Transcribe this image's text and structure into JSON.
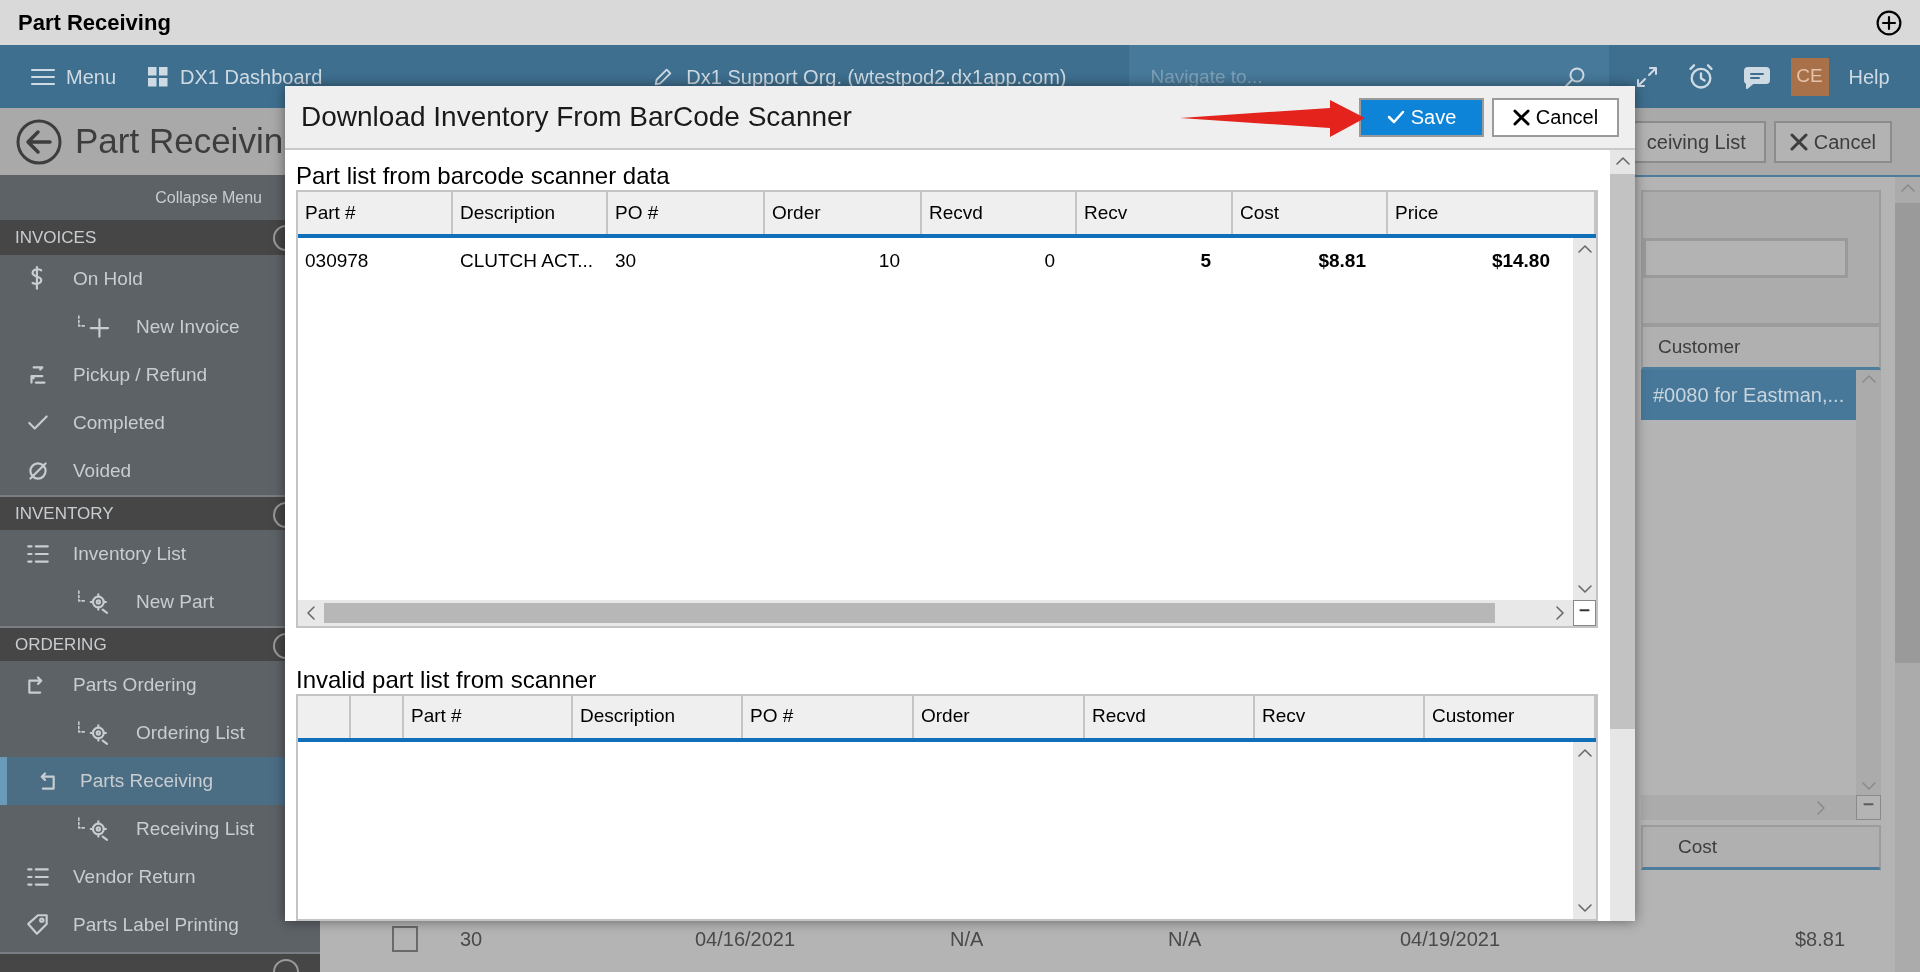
{
  "app_title": "Part Receiving",
  "nav": {
    "menu": "Menu",
    "dashboard": "DX1 Dashboard",
    "org": "Dx1 Support Org. (wtestpod2.dx1app.com)",
    "search_placeholder": "Navigate to...",
    "avatar": "CE",
    "help": "Help"
  },
  "sidebar": {
    "collapse": "Collapse Menu",
    "sections": [
      {
        "title": "INVOICES",
        "items": [
          {
            "label": "On Hold",
            "selected": false,
            "children": [
              {
                "label": "New Invoice",
                "selected": false
              }
            ]
          },
          {
            "label": "Pickup / Refund",
            "selected": false
          },
          {
            "label": "Completed",
            "selected": false
          },
          {
            "label": "Voided",
            "selected": false
          }
        ]
      },
      {
        "title": "INVENTORY",
        "items": [
          {
            "label": "Inventory List",
            "selected": false,
            "children": [
              {
                "label": "New Part",
                "selected": false
              }
            ]
          }
        ]
      },
      {
        "title": "ORDERING",
        "items": [
          {
            "label": "Parts Ordering",
            "selected": false,
            "children": [
              {
                "label": "Ordering List",
                "selected": false
              }
            ]
          },
          {
            "label": "Parts Receiving",
            "selected": true,
            "children": [
              {
                "label": "Receiving List",
                "selected": false
              }
            ]
          },
          {
            "label": "Vendor Return",
            "selected": false
          },
          {
            "label": "Parts Label Printing",
            "selected": false
          }
        ]
      }
    ]
  },
  "page": {
    "heading": "Part Receivin",
    "list_button": "ceiving List",
    "cancel_button": "Cancel",
    "customer_header": "Customer",
    "selected_row": "#0080 for Eastman,...",
    "cost_header": "Cost",
    "bottom_row": {
      "checked": false,
      "cells": [
        "30",
        "04/16/2021",
        "N/A",
        "N/A",
        "04/19/2021",
        "$8.81"
      ]
    }
  },
  "dialog": {
    "title": "Download Inventory From BarCode Scanner",
    "save": "Save",
    "cancel": "Cancel",
    "valid": {
      "title": "Part list from barcode scanner data",
      "columns": [
        "Part #",
        "Description",
        "PO #",
        "Order",
        "Recvd",
        "Recv",
        "Cost",
        "Price"
      ],
      "rows": [
        [
          "030978",
          "CLUTCH ACT...",
          "30",
          "10",
          "0",
          "5",
          "$8.81",
          "$14.80"
        ]
      ]
    },
    "invalid": {
      "title": "Invalid part list from scanner",
      "columns": [
        "",
        "",
        "Part #",
        "Description",
        "PO #",
        "Order",
        "Recvd",
        "Recv",
        "Customer"
      ]
    }
  }
}
